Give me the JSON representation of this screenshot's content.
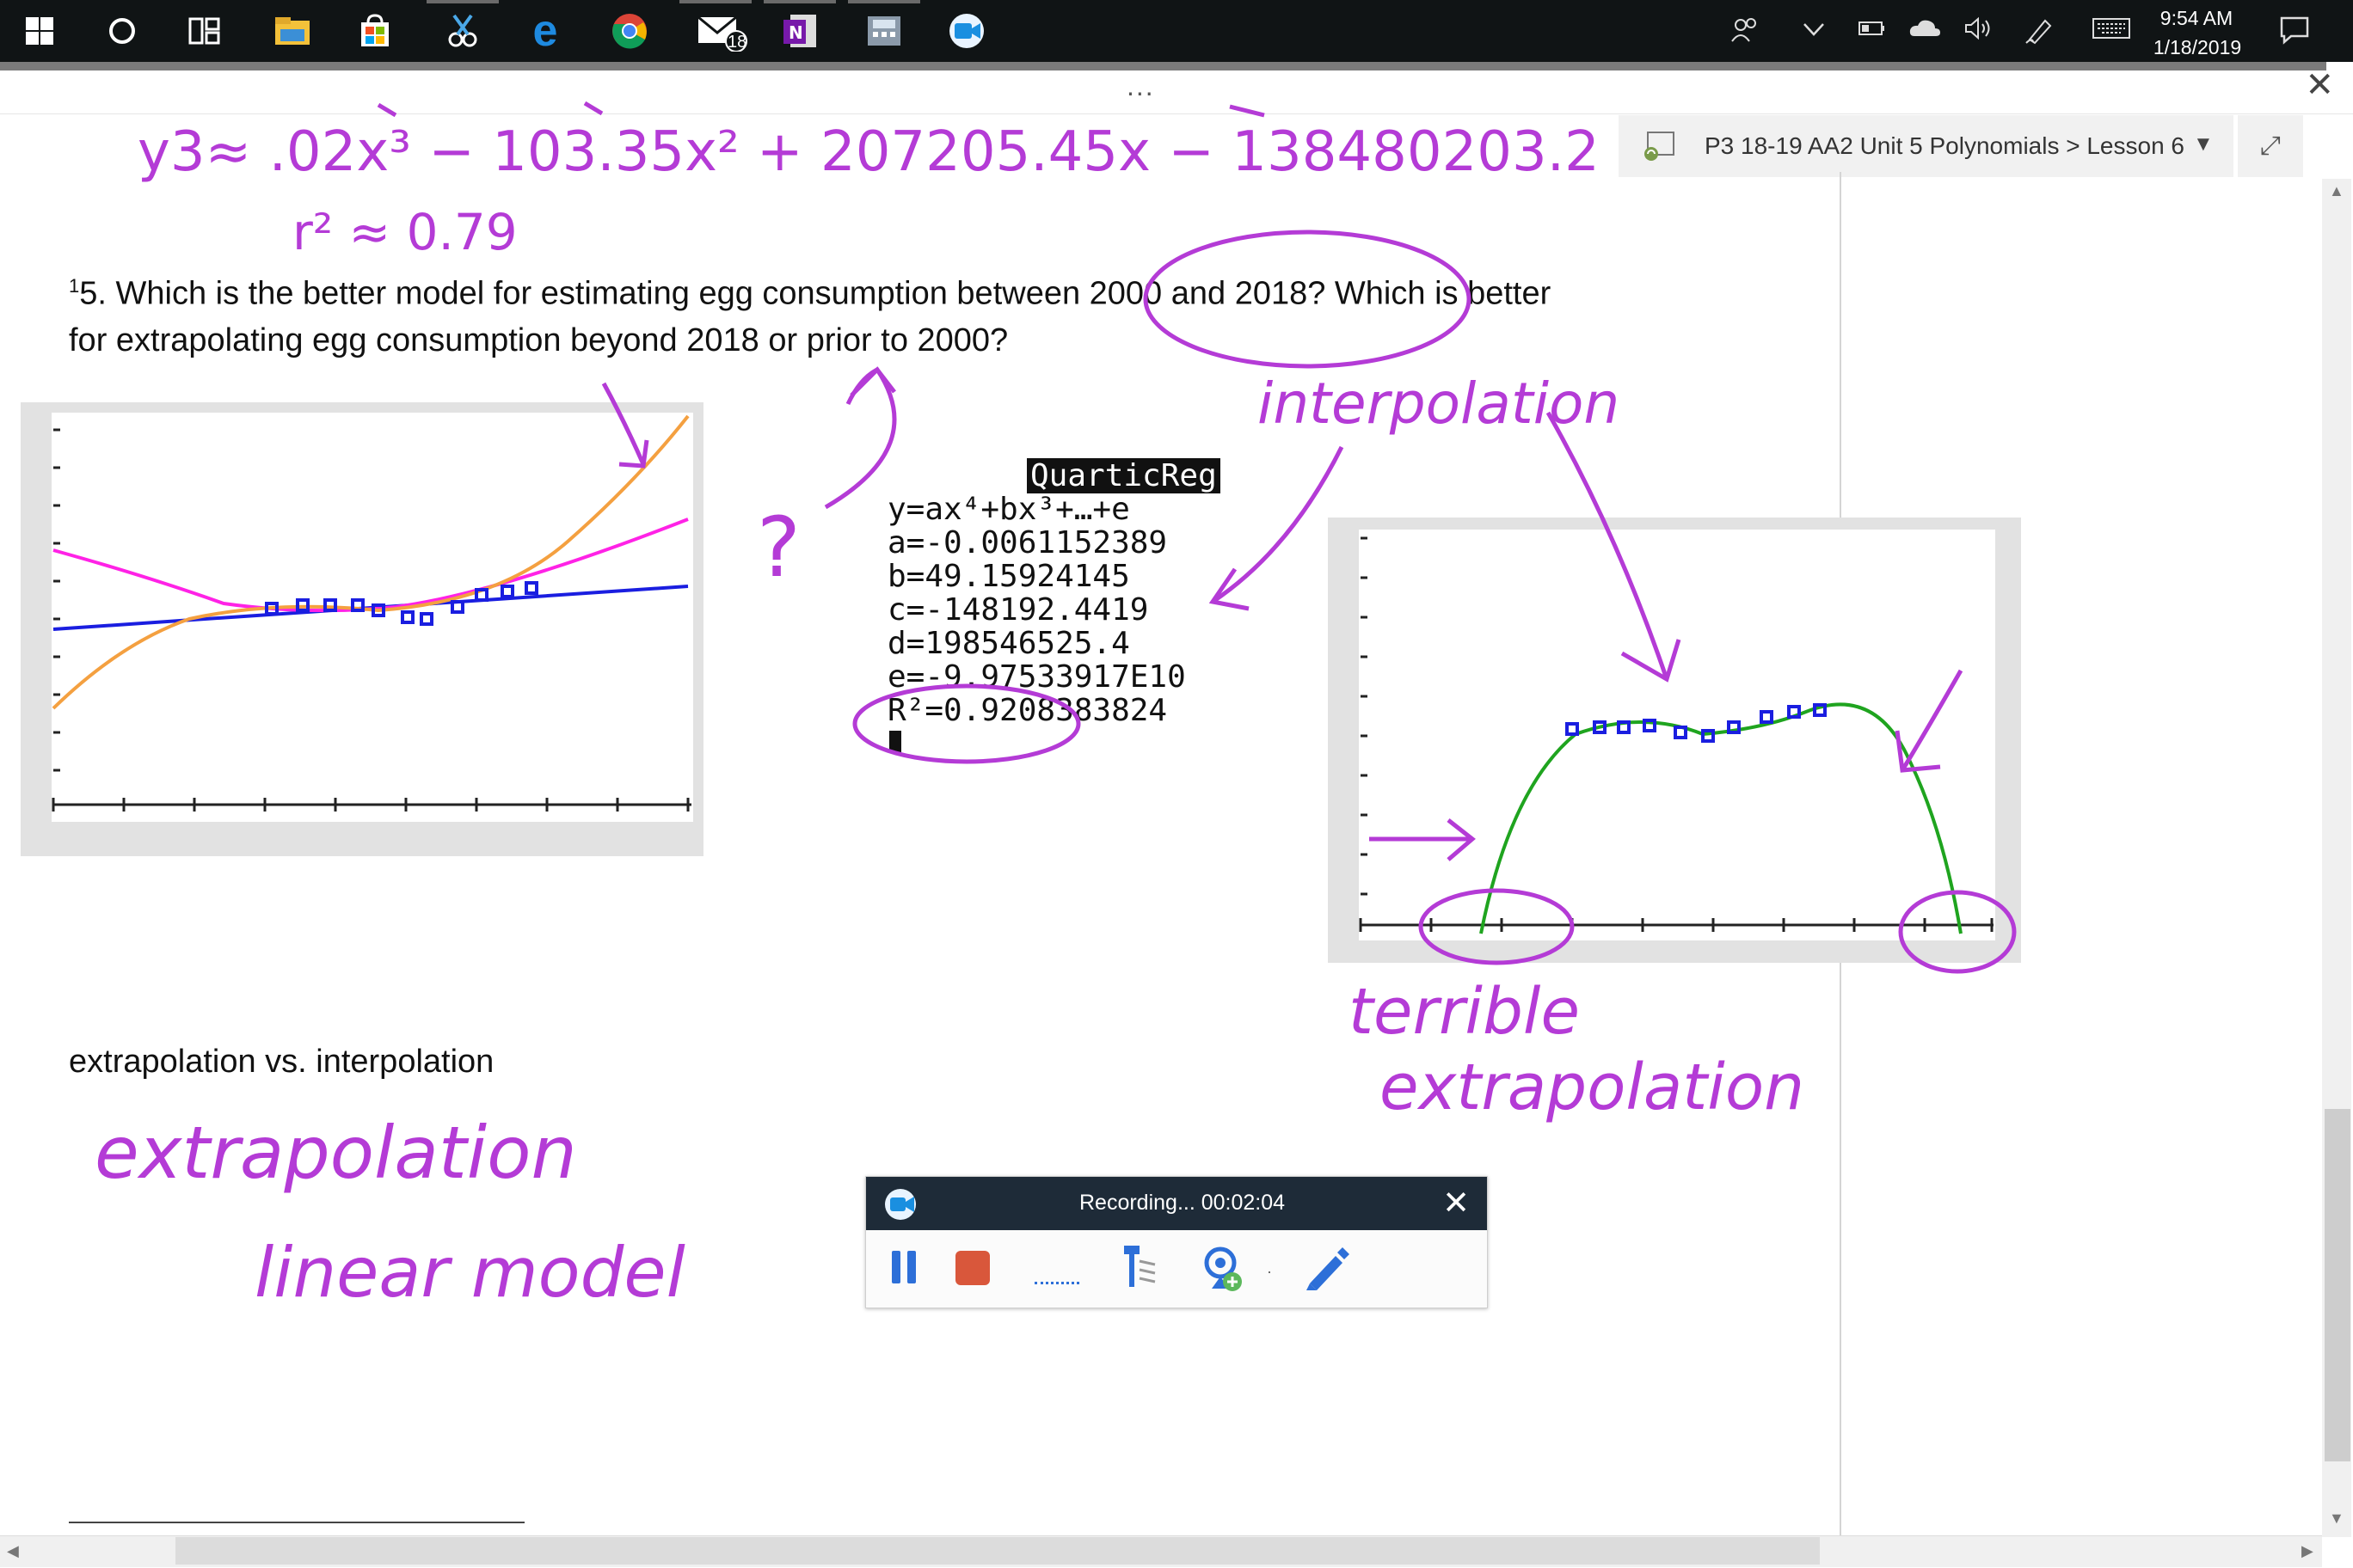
{
  "taskbar": {
    "icons": [
      "windows-start-icon",
      "cortana-icon",
      "task-view-icon",
      "file-explorer-icon",
      "store-icon",
      "snipping-tool-icon",
      "edge-icon",
      "chrome-icon",
      "mail-icon",
      "onenote-icon",
      "calculator-icon",
      "screencast-icon"
    ],
    "mail_badge": "18",
    "time": "9:54 AM",
    "date": "1/18/2019"
  },
  "window": {
    "more_label": "...",
    "close_label": "✕"
  },
  "notebook": {
    "breadcrumb": "P3 18-19 AA2 Unit 5 Polynomials > Lesson 6",
    "expand_label": "⤢"
  },
  "page": {
    "question_number": "1",
    "question_line1": "5.  Which is the better model for estimating egg consumption between 2000 and 2018?  Which is better",
    "question_line2": "for extrapolating egg consumption beyond 2018 or prior to 2000?",
    "extra_label": "extrapolation vs. interpolation"
  },
  "calculator": {
    "title": "QuarticReg",
    "lines": [
      "y=ax⁴+bx³+…+e",
      "a=-0.0061152389",
      "b=49.15924145",
      "c=-148192.4419",
      "d=198546525.4",
      "e=-9.97533917E10",
      "R²=0.9208383824"
    ]
  },
  "ink": {
    "equation": "y3≈ .02x³ − 103.35x² + 207205.45x − 138480203.2",
    "r2": "r² ≈ 0.79",
    "question_mark": "?",
    "interpolation": "interpolation",
    "terrible": "terrible",
    "extrapolation_right": "extrapolation",
    "extrapolation_left": "extrapolation",
    "linear_model": "linear model"
  },
  "recorder": {
    "status": "Recording... 00:02:04",
    "close_label": "✕"
  },
  "colors": {
    "ink": "#b43bd6",
    "taskbar": "#101415",
    "recorder_header": "#1e2b38",
    "stop_button": "#d9573b",
    "pause_button": "#2d6fd8"
  }
}
